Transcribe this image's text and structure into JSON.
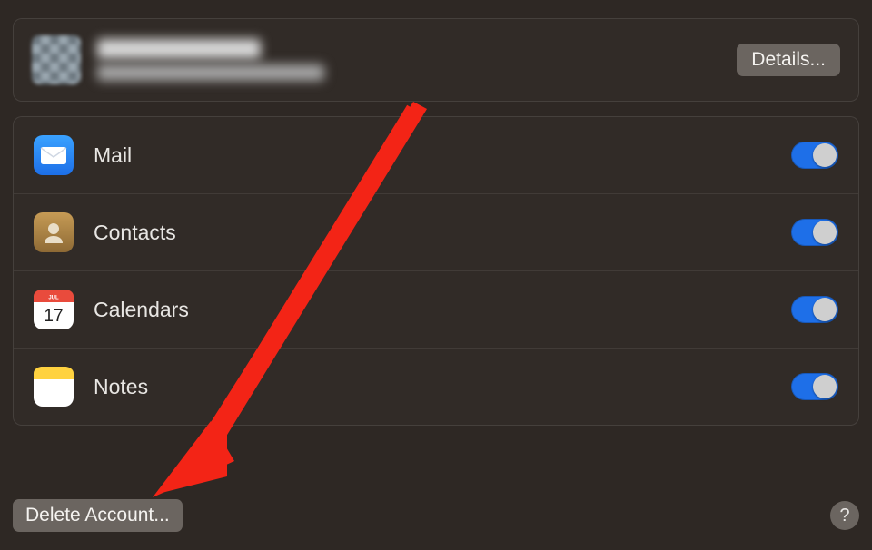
{
  "account": {
    "name": "",
    "email": "",
    "details_label": "Details..."
  },
  "services": [
    {
      "id": "mail",
      "label": "Mail",
      "enabled": true
    },
    {
      "id": "contacts",
      "label": "Contacts",
      "enabled": true
    },
    {
      "id": "calendars",
      "label": "Calendars",
      "enabled": true
    },
    {
      "id": "notes",
      "label": "Notes",
      "enabled": true
    }
  ],
  "buttons": {
    "delete_account": "Delete Account...",
    "help": "?"
  },
  "colors": {
    "accent": "#1e6fe8",
    "arrow": "#f32416"
  }
}
